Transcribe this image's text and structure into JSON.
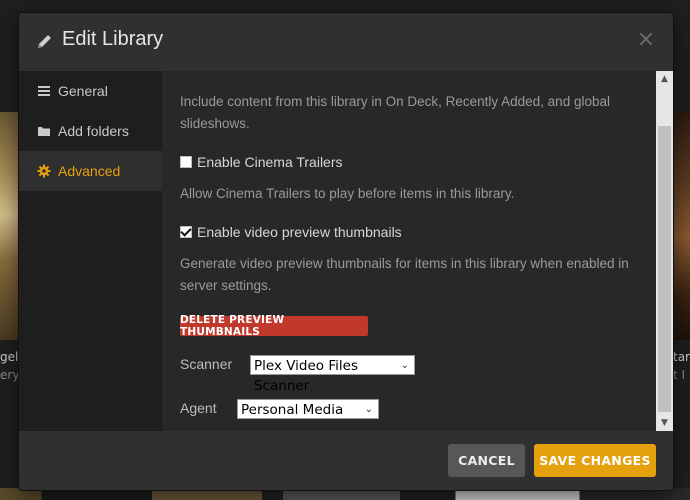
{
  "background": {
    "left_title": "gel",
    "left_sub": "ery",
    "right_title": "tar",
    "right_sub": "t I"
  },
  "modal": {
    "title": "Edit Library",
    "title_icon": "pencil-icon",
    "close_icon": "close-icon",
    "close_glyph": "×"
  },
  "sidebar": {
    "items": [
      {
        "label": "General",
        "icon": "list-icon",
        "active": false
      },
      {
        "label": "Add folders",
        "icon": "folder-icon",
        "active": false
      },
      {
        "label": "Advanced",
        "icon": "gear-icon",
        "active": true
      }
    ]
  },
  "content": {
    "include_desc": "Include content from this library in On Deck, Recently Added, and global slideshows.",
    "cinema_trailers": {
      "label": "Enable Cinema Trailers",
      "checked": false
    },
    "cinema_desc": "Allow Cinema Trailers to play before items in this library.",
    "video_preview": {
      "label": "Enable video preview thumbnails",
      "checked": true
    },
    "preview_desc": "Generate video preview thumbnails for items in this library when enabled in server settings.",
    "delete_button": "DELETE PREVIEW THUMBNAILS",
    "scanner": {
      "label": "Scanner",
      "value": "Plex Video Files Scanner"
    },
    "agent": {
      "label": "Agent",
      "value": "Personal Media"
    }
  },
  "footer": {
    "cancel_label": "CANCEL",
    "save_label": "SAVE CHANGES"
  },
  "colors": {
    "accent": "#e5a00d",
    "danger": "#c0392b",
    "panel": "#282828"
  }
}
